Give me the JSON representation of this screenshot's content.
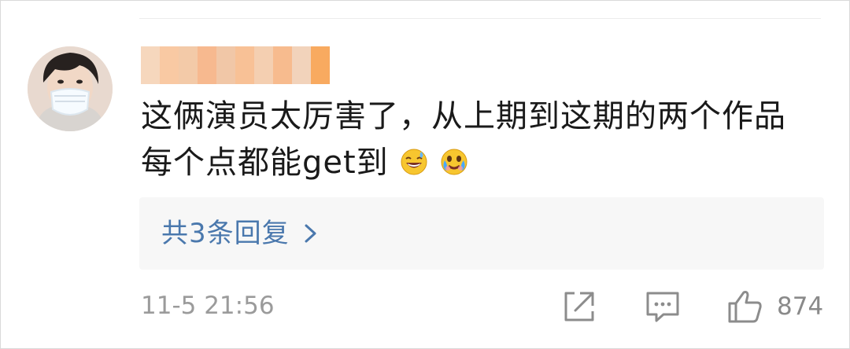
{
  "comment": {
    "text": "这俩演员太厉害了，从上期到这期的两个作品每个点都能get到",
    "emojis": [
      "grinning-sweat-emoji",
      "tears-of-joy-emoji"
    ],
    "replies_label": "共3条回复",
    "timestamp": "11-5 21:56",
    "like_count": "874"
  },
  "colors": {
    "text": "#1a1a1a",
    "link": "#4a78ad",
    "muted": "#9b9b9b",
    "reply_box_bg": "#f7f7f7",
    "username_blur": [
      "#f6d7bd",
      "#f9c9a3",
      "#f3caa8",
      "#f7b98f",
      "#f1c7a7",
      "#f8c196",
      "#f4cfb1",
      "#f7bb8e",
      "#f2d3bb",
      "#f8aa60"
    ]
  },
  "icons": {
    "share": "share-icon",
    "comment": "comment-icon",
    "like": "thumbs-up-icon",
    "chevron": "chevron-right-icon"
  }
}
